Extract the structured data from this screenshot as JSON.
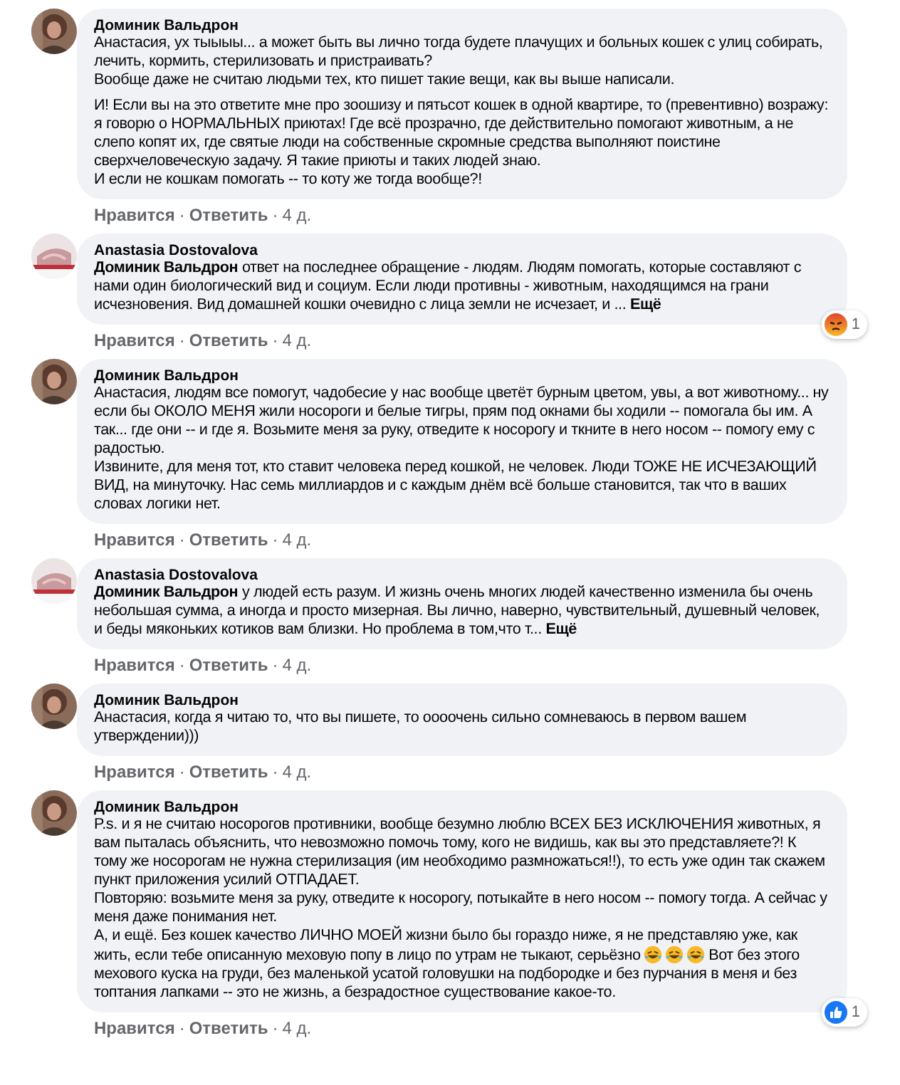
{
  "separator": "·",
  "comments": [
    {
      "author": "Доминик Вальдрон",
      "paragraphs": [
        "Анастасия, ух тыыыы... а может быть вы лично тогда будете плачущих и больных кошек с улиц собирать, лечить, кормить, стерилизовать и пристраивать?\nВообще даже не считаю людьми тех, кто пишет такие вещи, как вы выше написали.",
        "И! Если вы на это ответите мне про зоошизу и пятьсот кошек в одной квартире, то (превентивно) возражу: я говорю о НОРМАЛЬНЫХ приютах! Где всё прозрачно, где действительно помогают животным, а не слепо копят их, где святые люди на собственные скромные средства выполняют поистине сверхчеловеческую задачу. Я такие приюты и таких людей знаю.\nИ если не кошкам помогать -- то коту же тогда вообще?!"
      ],
      "actions": [
        "Нравится",
        "Ответить"
      ],
      "time": "4 д."
    },
    {
      "author": "Anastasia Dostovalova",
      "paragraphs": [
        "**Доминик Вальдрон** ответ на последнее обращение - людям. Людям помогать, которые составляют с нами один биологический вид и социум. Если люди противны - животным, находящимся на грани исчезновения. Вид домашней кошки очевидно с лица земли не исчезает, и ..."
      ],
      "more": "Ещё",
      "reaction": {
        "kind": "angry",
        "count": "1"
      },
      "actions": [
        "Нравится",
        "Ответить"
      ],
      "time": "4 д."
    },
    {
      "author": "Доминик Вальдрон",
      "paragraphs": [
        "Анастасия, людям все помогут, чадобесие у нас вообще цветёт бурным цветом, увы, а вот животному... ну если бы ОКОЛО МЕНЯ жили носороги и белые тигры, прям под окнами бы ходили -- помогала бы им. А так... где они -- и где я. Возьмите меня за руку, отведите к носорогу и ткните в него носом -- помогу ему с радостью.\nИзвините, для меня тот, кто ставит человека перед кошкой, не человек. Люди ТОЖЕ НЕ ИСЧЕЗАЮЩИЙ ВИД, на минуточку. Нас семь миллиардов и с каждым днём всё больше становится, так что в ваших словах логики нет."
      ],
      "actions": [
        "Нравится",
        "Ответить"
      ],
      "time": "4 д."
    },
    {
      "author": "Anastasia Dostovalova",
      "paragraphs": [
        "**Доминик Вальдрон** у людей есть разум. И жизнь очень многих людей качественно изменила бы очень небольшая сумма, а иногда и просто мизерная. Вы лично, наверно, чувствительный, душевный человек, и беды мяконьких котиков вам близки. Но проблема в том,что т..."
      ],
      "more": "Ещё",
      "actions": [
        "Нравится",
        "Ответить"
      ],
      "time": "4 д."
    },
    {
      "author": "Доминик Вальдрон",
      "paragraphs": [
        "Анастасия, когда я читаю то, что вы пишете, то оооочень сильно сомневаюсь в первом вашем утверждении)))"
      ],
      "actions": [
        "Нравится",
        "Ответить"
      ],
      "time": "4 д."
    },
    {
      "author": "Доминик Вальдрон",
      "paragraphs": [
        [
          "P.s. и я не считаю носорогов противники, вообще безумно люблю ВСЕХ БЕЗ ИСКЛЮЧЕНИЯ животных, я вам пыталась объяснить, что невозможно помочь тому, кого не видишь, как вы это представляете?! К тому же носорогам не нужна стерилизация (им необходимо размножаться!!), то есть уже один так скажем пункт приложения усилий ОТПАДАЕТ.\nПовторяю: возьмите меня за руку, отведите к носорогу, потыкайте в него носом -- помогу тогда. А сейчас у меня даже понимания нет.\nА, и ещё. Без кошек качество ЛИЧНО МОЕЙ жизни было бы гораздо ниже, я не представляю уже, как жить, если тебе описанную меховую попу в лицо по утрам не тыкают, серьёзно",
          {
            "kind": "laugh_emoji"
          },
          {
            "kind": "laugh_emoji"
          },
          {
            "kind": "laugh_emoji"
          },
          " Вот без этого мехового куска на груди, без маленькой усатой головушки на подбородке и без пурчания в меня и без топтания лапками -- это не жизнь, а безрадостное существование какое-то."
        ]
      ],
      "reaction": {
        "kind": "like",
        "count": "1"
      },
      "actions": [
        "Нравится",
        "Ответить"
      ],
      "time": "4 д."
    }
  ]
}
